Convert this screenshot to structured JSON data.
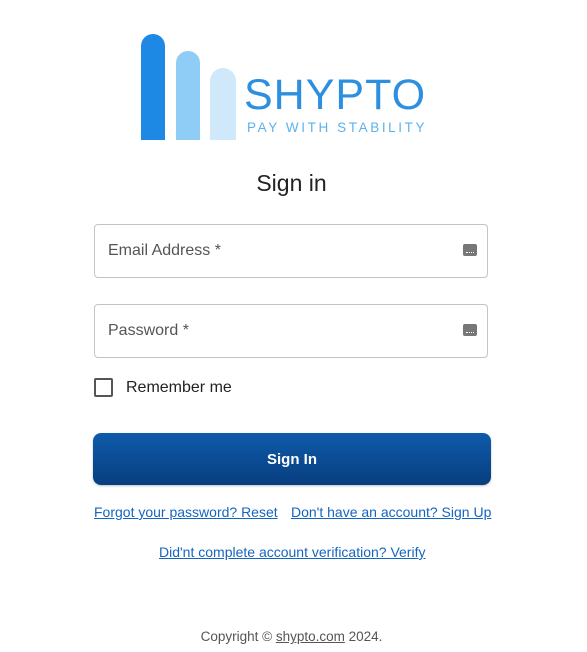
{
  "logo": {
    "brand_name": "SHYPTO",
    "tagline": "PAY WITH STABILITY",
    "colors": [
      "#1e88e5",
      "#8fcdf7",
      "#cfe9fb"
    ]
  },
  "title": "Sign in",
  "form": {
    "email_label": "Email Address *",
    "password_label": "Password *",
    "remember_label": "Remember me",
    "remember_checked": false,
    "submit_label": "Sign In"
  },
  "links": {
    "forgot": "Forgot your password? Reset",
    "signup": "Don't have an account? Sign Up",
    "verify": "Did'nt complete account verification? Verify"
  },
  "footer": {
    "prefix": "Copyright ©",
    "domain": "shypto.com",
    "year": "2024."
  },
  "accent_color": "#0e5bab"
}
